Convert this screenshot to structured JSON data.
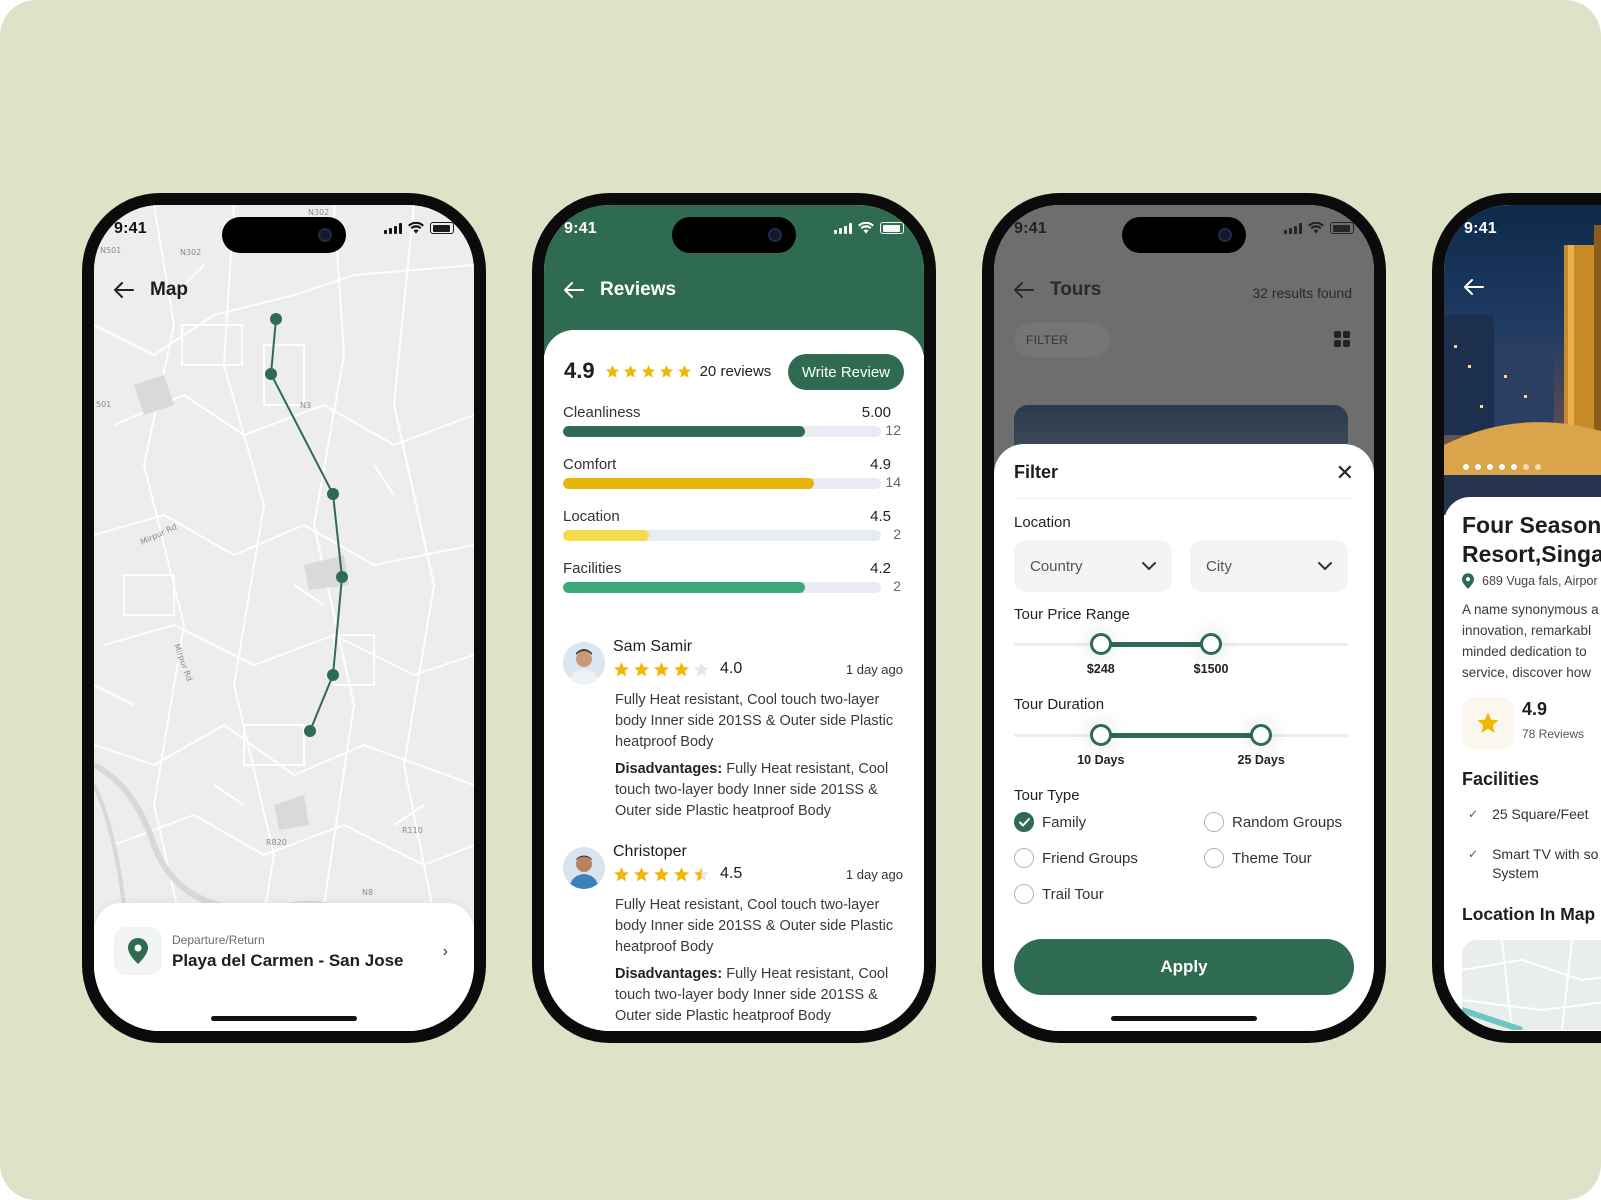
{
  "status_time": "9:41",
  "colors": {
    "primary": "#2f6b52",
    "star": "#f2b705",
    "background": "#dde3c7"
  },
  "map_screen": {
    "title": "Map",
    "map_labels": [
      "N302",
      "N501",
      "N302",
      "N3",
      "501",
      "Mirpur Rd",
      "Mirpur Rd",
      "R820",
      "R110",
      "N8"
    ],
    "card": {
      "label": "Departure/Return",
      "value": "Playa del Carmen - San Jose"
    }
  },
  "reviews_screen": {
    "title": "Reviews",
    "overall": "4.9",
    "total": "20 reviews",
    "write_button": "Write Review",
    "categories": [
      {
        "name": "Cleanliness",
        "score": "5.00",
        "count": "12",
        "fill": 0.76,
        "color": "#2f6b52"
      },
      {
        "name": "Comfort",
        "score": "4.9",
        "count": "14",
        "fill": 0.79,
        "color": "#e7b50a"
      },
      {
        "name": "Location",
        "score": "4.5",
        "count": "2",
        "fill": 0.27,
        "color": "#f5dc4c"
      },
      {
        "name": "Facilities",
        "score": "4.2",
        "count": "2",
        "fill": 0.76,
        "color": "#3ba87a"
      }
    ],
    "reviews": [
      {
        "name": "Sam Samir",
        "rating": "4.0",
        "stars": 4,
        "ago": "1 day ago",
        "body": "Fully Heat resistant, Cool touch two-layer body  Inner side 201SS & Outer side Plastic heatproof Body",
        "dis_label": "Disadvantages:",
        "dis_body": " Fully Heat resistant, Cool touch two-layer body  Inner side 201SS & Outer side Plastic heatproof Body"
      },
      {
        "name": "Christoper",
        "rating": "4.5",
        "stars": 4.5,
        "ago": "1 day ago",
        "body": "Fully Heat resistant, Cool touch two-layer body  Inner side 201SS & Outer side Plastic heatproof Body",
        "dis_label": "Disadvantages:",
        "dis_body": " Fully Heat resistant, Cool touch two-layer body  Inner side 201SS & Outer side Plastic heatproof Body"
      }
    ]
  },
  "tours_screen": {
    "title": "Tours",
    "results": "32 results found",
    "filter_chip": "FILTER",
    "sheet": {
      "title": "Filter",
      "location_label": "Location",
      "country_placeholder": "Country",
      "city_placeholder": "City",
      "price_label": "Tour Price Range",
      "price_low": "$248",
      "price_high": "$1500",
      "price_low_pos": 0.26,
      "price_high_pos": 0.59,
      "duration_label": "Tour Duration",
      "duration_low": "10 Days",
      "duration_high": "25 Days",
      "duration_low_pos": 0.26,
      "duration_high_pos": 0.74,
      "type_label": "Tour Type",
      "types": [
        {
          "label": "Family",
          "checked": true
        },
        {
          "label": "Random Groups",
          "checked": false
        },
        {
          "label": "Friend Groups",
          "checked": false
        },
        {
          "label": "Theme Tour",
          "checked": false
        },
        {
          "label": "Trail Tour",
          "checked": false
        }
      ],
      "apply": "Apply"
    }
  },
  "hotel_screen": {
    "title_line1": "Four Season",
    "title_line2": "Resort,Singa",
    "address": "689 Vuga fals, Airpor",
    "description": [
      "A name synonymous a",
      "innovation, remarkabl",
      "minded dedication to",
      "service, discover how"
    ],
    "rating": "4.9",
    "reviews": "78 Reviews",
    "facilities_title": "Facilities",
    "facilities": [
      "25 Square/Feet",
      "Smart TV with so\nSystem"
    ],
    "location_title": "Location In Map"
  }
}
